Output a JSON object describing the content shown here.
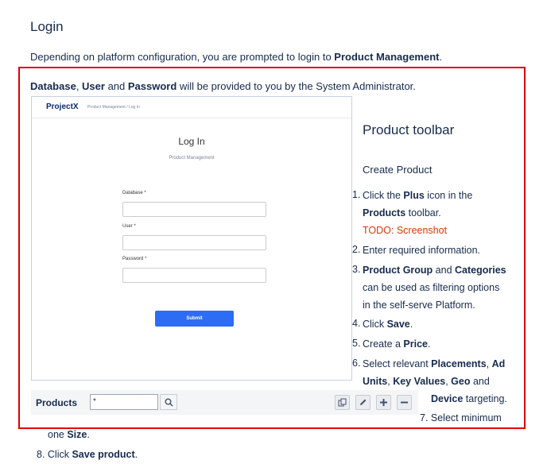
{
  "page": {
    "title": "Login",
    "intro_prefix": "Depending on platform configuration, you are prompted to login to ",
    "intro_bold": "Product Management",
    "intro_suffix": "."
  },
  "credentials": {
    "database": "Database",
    "sep1": ", ",
    "user": "User",
    "and": " and ",
    "password": "Password",
    "rest": " will be provided to you by the System Administrator."
  },
  "login_screen": {
    "logo": "ProjectX",
    "breadcrumb": "Product Management / Log In",
    "title": "Log In",
    "subtitle": "Product Management",
    "database_label": "Database *",
    "user_label": "User *",
    "password_label": "Password *",
    "submit_label": "Submit"
  },
  "right": {
    "heading": "Product toolbar",
    "subheading": "Create Product"
  },
  "steps": {
    "n1": "1.",
    "s1_a": "Click the ",
    "s1_b": "Plus",
    "s1_c": " icon in the",
    "s1_d": "Products",
    "s1_e": " toolbar.",
    "todo": "TODO: Screenshot",
    "n2": "2.",
    "s2": "Enter required information.",
    "n3": "3.",
    "s3_a": "Product Group",
    "s3_b": " and ",
    "s3_c": "Categories",
    "s3_d": "can be used as filtering options",
    "s3_e": "in the self-serve Platform.",
    "n4": "4.",
    "s4_a": "Click ",
    "s4_b": "Save",
    "s4_c": ".",
    "n5": "5.",
    "s5_a": "Create a ",
    "s5_b": "Price",
    "s5_c": ".",
    "n6": "6.",
    "s6_a": "Select relevant ",
    "s6_b": "Placements",
    "s6_c": ", ",
    "s6_d": "Ad",
    "s6_e": "Units",
    "s6_f": ", ",
    "s6_g": "Key Values",
    "s6_h": ", ",
    "s6_i": "Geo",
    "s6_j": " and",
    "s6_k": "Device",
    "s6_l": " targeting.",
    "s7_a": "7. Select minimum",
    "s7_b": "one ",
    "s7_c": "Size",
    "s7_d": ".",
    "s8_a": "8. Click ",
    "s8_b": "Save product",
    "s8_c": "."
  },
  "toolbar": {
    "label": "Products",
    "search_value": "*",
    "icons": [
      "search-icon",
      "copy-icon",
      "edit-icon",
      "plus-icon",
      "minus-icon"
    ]
  },
  "colors": {
    "highlight_border": "#e00000",
    "todo": "#de350b",
    "submit": "#2d6cf5"
  }
}
